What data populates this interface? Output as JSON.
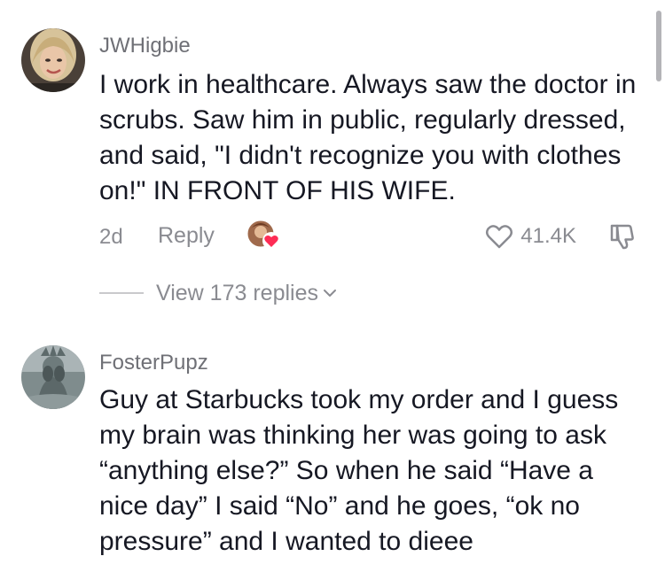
{
  "comments": [
    {
      "username": "JWHigbie",
      "text": "I work in healthcare. Always saw the doctor in scrubs. Saw him in public, regularly dressed, and said, \"I didn't recognize you with clothes on!\" IN FRONT OF HIS WIFE.",
      "age": "2d",
      "reply_label": "Reply",
      "like_count": "41.4K",
      "view_replies_label": "View 173 replies",
      "icons": [
        "avatar",
        "liked-by-creator-avatar",
        "heart-icon",
        "dislike-icon",
        "chevron-down-icon"
      ]
    },
    {
      "username": "FosterPupz",
      "text": "Guy at Starbucks took my order and I guess my brain was thinking her was going to ask “anything else?” So when he said “Have a nice day” I said “No” and he goes, “ok no pressure” and I wanted to dieee",
      "icons": [
        "avatar"
      ]
    }
  ],
  "colors": {
    "text": "#161823",
    "secondary": "#8a8b91",
    "username": "#6f7076",
    "heart_badge": "#fe2c55"
  }
}
